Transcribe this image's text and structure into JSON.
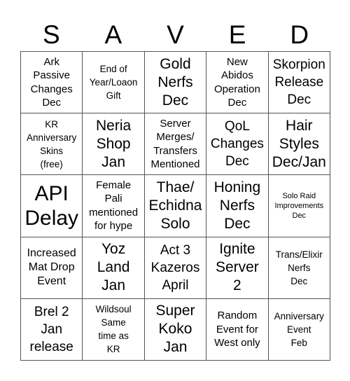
{
  "header": {
    "letters": [
      "S",
      "A",
      "V",
      "E",
      "D"
    ]
  },
  "board": {
    "cells": [
      [
        "Ark\nPassive\nChanges\nDec",
        "End of\nYear/Loaon\nGift",
        "Gold\nNerfs\nDec",
        "New\nAbidos\nOperation\nDec",
        "Skorpion\nRelease\nDec"
      ],
      [
        "KR\nAnniversary\nSkins\n(free)",
        "Neria\nShop\nJan",
        "Server\nMerges/\nTransfers\nMentioned",
        "QoL\nChanges\nDec",
        "Hair\nStyles\nDec/Jan"
      ],
      [
        "API\nDelay",
        "Female\nPali\nmentioned\nfor hype",
        "Thae/\nEchidna\nSolo",
        "Honing\nNerfs\nDec",
        "Solo Raid\nImprovements\nDec"
      ],
      [
        "Increased\nMat Drop\nEvent",
        "Yoz\nLand\nJan",
        "Act 3\nKazeros\nApril",
        "Ignite\nServer\n2",
        "Trans/Elixir\nNerfs\nDec"
      ],
      [
        "Brel 2\nJan\nrelease",
        "Wildsoul\nSame\ntime as\nKR",
        "Super\nKoko\nJan",
        "Random\nEvent for\nWest only",
        "Anniversary\nEvent\nFeb"
      ]
    ]
  }
}
